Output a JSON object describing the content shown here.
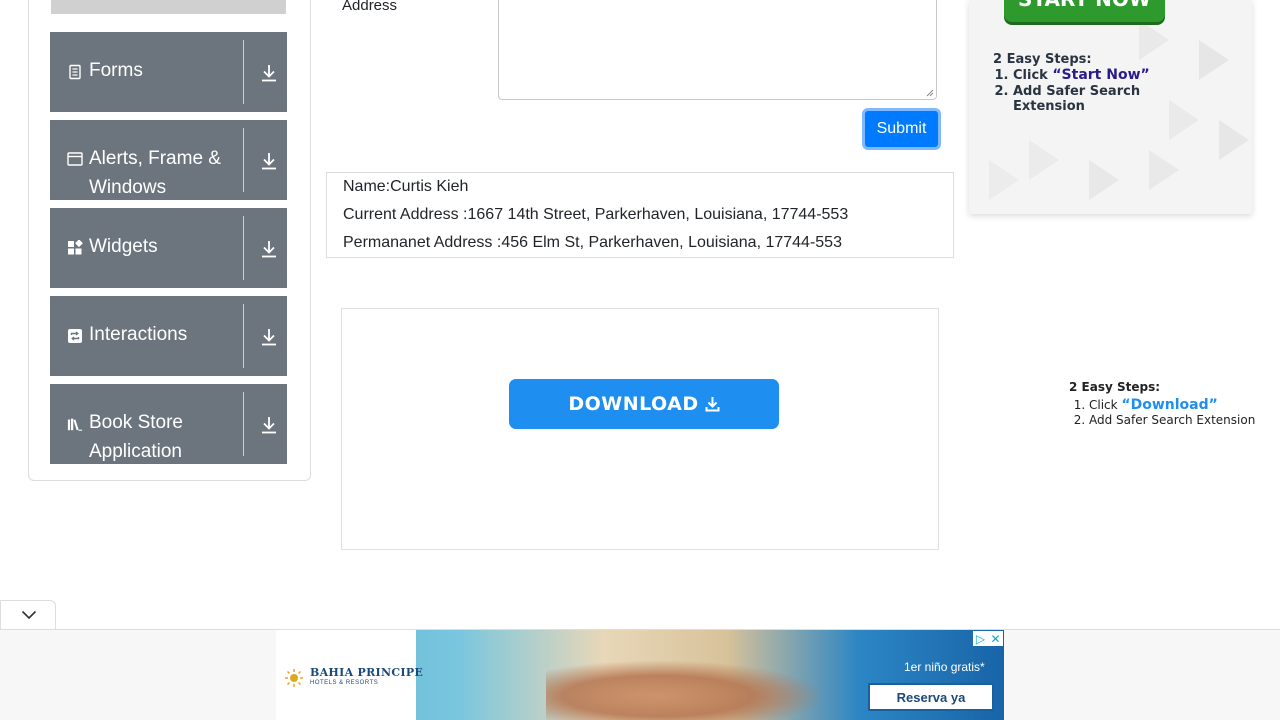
{
  "sidebar": {
    "groups": [
      {
        "label": "Forms",
        "icon": "document-icon"
      },
      {
        "label": "Alerts, Frame & Windows",
        "icon": "window-icon"
      },
      {
        "label": "Widgets",
        "icon": "widgets-icon"
      },
      {
        "label": "Interactions",
        "icon": "interactions-icon"
      },
      {
        "label": "Book Store Application",
        "icon": "library-icon"
      }
    ]
  },
  "form": {
    "address_label": "Address",
    "submit_label": "Submit"
  },
  "output": {
    "name": "Name:Curtis Kieh",
    "current_address": "Current Address :1667 14th Street, Parkerhaven, Louisiana, 17744-553",
    "permanent_address": "Permananet Address :456 Elm St, Parkerhaven, Louisiana, 17744-553"
  },
  "download_ad": {
    "button_label": "DOWNLOAD"
  },
  "right_ad_top": {
    "button_label": "START NOW",
    "steps_title": "2 Easy Steps:",
    "step1_prefix": "Click ",
    "step1_highlight": "“Start Now”",
    "step2": "Add Safer Search Extension"
  },
  "right_ad_bottom": {
    "steps_title": "2 Easy Steps:",
    "step1_prefix": "Click ",
    "step1_highlight": "“Download”",
    "step2": "Add Safer Search Extension"
  },
  "banner": {
    "brand": "BAHIA PRINCIPE",
    "brand_sub": "HOTELS & RESORTS",
    "offer": "1er niño gratis*",
    "cta": "Reserva ya"
  },
  "colors": {
    "sidebar_bg": "#6c757d",
    "submit_bg": "#007bff",
    "download_bg": "#1e8ff0",
    "start_now_bg": "#2e9a2e"
  }
}
